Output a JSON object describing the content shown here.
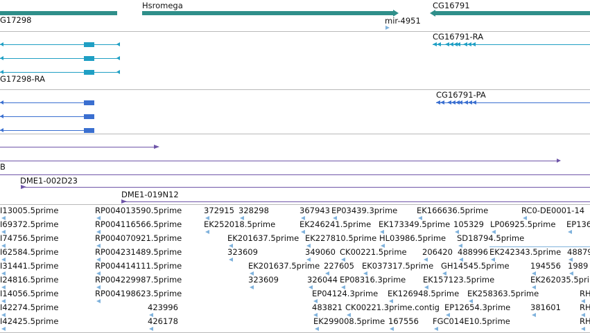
{
  "colors": {
    "gene": "#2f8f8a",
    "transcript_ra": "#1f9fc4",
    "transcript_pa": "#3a6fd0",
    "clone": "#6e55a8",
    "est": "#7fb2dc",
    "divider": "#b9b9b9"
  },
  "genes": [
    {
      "name": ""
    },
    {
      "name": "Hsromega"
    },
    {
      "name": "CG16791"
    }
  ],
  "gene_row_labels": [
    "G17298",
    "mir-4951"
  ],
  "transcripts_ra": {
    "left_label": "G17298-RA",
    "right_label": "CG16791-RA"
  },
  "transcripts_pa": {
    "right_label": "CG16791-PA"
  },
  "clones": [
    "B",
    "DME1-002D23",
    "DME1-019N12"
  ],
  "est_rows": [
    [
      "I13005.5prime",
      "RP004013590.5prime",
      "372915",
      "328298",
      "367943",
      "EP03439.3prime",
      "EK166636.5prime",
      "RC0-DE0001-14"
    ],
    [
      "I69372.5prime",
      "RP004116566.5prime",
      "EK252018.5prime",
      "EK246241.5prime",
      "EK173349.5prime",
      "105329",
      "LP06925.5prime",
      "EP136"
    ],
    [
      "I74756.5prime",
      "RP004070921.5prime",
      "EK201637.5prime",
      "EK227810.5prime",
      "HL03986.5prime",
      "SD18794.5prime"
    ],
    [
      "I62584.5prime",
      "RP004231489.5prime",
      "323609",
      "349060",
      "CK00221.5prime",
      "206420",
      "488996",
      "EK242343.5prime",
      "48879"
    ],
    [
      "I31441.5prime",
      "RP004414111.5prime",
      "EK201637.5prime",
      "227605",
      "EK037317.5prime",
      "GH14545.5prime",
      "194556",
      "1989"
    ],
    [
      "I24816.5prime",
      "RP004229987.5prime",
      "323609",
      "326044",
      "EP08316.3prime",
      "EK157123.5prime",
      "EK262035.5pri"
    ],
    [
      "I14056.5prime",
      "RP004198623.5prime",
      "EP04124.3prime",
      "EK126948.5prime",
      "EK258363.5prime",
      "RH"
    ],
    [
      "I42274.5prime",
      "423996",
      "483821",
      "CK00221.3prime.contig",
      "EP12654.3prime",
      "381601",
      "RH"
    ],
    [
      "I42425.5prime",
      "426178",
      "EK299008.5prime",
      "167556",
      "FGC014E10.5prime",
      "RH"
    ]
  ]
}
